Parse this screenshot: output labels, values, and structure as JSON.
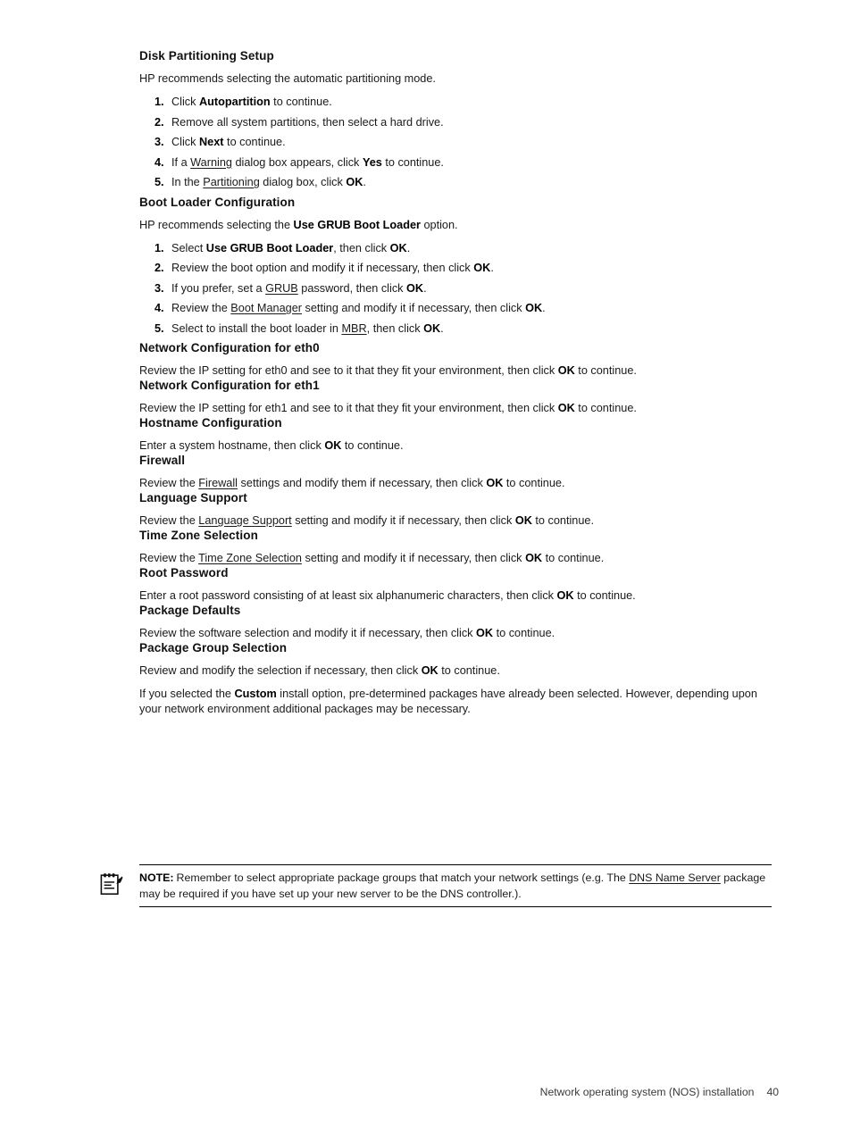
{
  "document": {
    "footer_text": "Network operating system (NOS) installation",
    "page_number": "40"
  },
  "sections": [
    {
      "id": "disk-partitioning-setup",
      "title": "Disk Partitioning Setup",
      "intro": "HP recommends selecting the automatic partitioning mode.",
      "steps": [
        {
          "num": "1.",
          "text_html": "Click <b>Autopartition</b> to continue."
        },
        {
          "num": "2.",
          "text_html": "Remove all system partitions, then select a hard drive."
        },
        {
          "num": "3.",
          "text_html": "Click <b>Next</b> to continue."
        },
        {
          "num": "4.",
          "text_html": "If a <u class=\"term\">Warning</u> dialog box appears, click <b>Yes</b> to continue."
        },
        {
          "num": "5.",
          "text_html": "In the <u class=\"term\">Partitioning</u> dialog box, click <b>OK</b>."
        }
      ]
    },
    {
      "id": "boot-loader-configuration",
      "title": "Boot Loader Configuration",
      "intro_html": "HP recommends selecting the <b>Use GRUB Boot Loader</b> option.",
      "steps": [
        {
          "num": "1.",
          "text_html": "Select <b>Use GRUB Boot Loader</b>, then click <b>OK</b>."
        },
        {
          "num": "2.",
          "text_html": "Review the boot option and modify it if necessary, then click <b>OK</b>."
        },
        {
          "num": "3.",
          "text_html": "If you prefer, set a <u class=\"term\">GRUB</u> password, then click <b>OK</b>."
        },
        {
          "num": "4.",
          "text_html": "Review the <u class=\"term\">Boot Manager</u> setting and modify it if necessary, then click <b>OK</b>."
        },
        {
          "num": "5.",
          "text_html": "Select to install the boot loader in <u class=\"term\">MBR</u>, then click <b>OK</b>."
        }
      ]
    },
    {
      "id": "network-configuration-eth0",
      "title": "Network Configuration for eth0",
      "body_html": "Review the IP setting for eth0 and see to it that they fit your environment, then click <b>OK</b> to continue."
    },
    {
      "id": "network-configuration-eth1",
      "title": "Network Configuration for eth1",
      "body_html": "Review the IP setting for eth1 and see to it that they fit your environment, then click <b>OK</b> to continue."
    },
    {
      "id": "hostname-configuration",
      "title": "Hostname Configuration",
      "body_html": "Enter a system hostname, then click <b>OK</b> to continue."
    },
    {
      "id": "firewall",
      "title": "Firewall",
      "body_html": "Review the <u class=\"term\">Firewall</u> settings and modify them if necessary, then click <b>OK</b> to continue."
    },
    {
      "id": "language-support",
      "title": "Language Support",
      "body_html": "Review the <u class=\"term\">Language Support</u> setting and modify it if necessary, then click <b>OK</b> to continue."
    },
    {
      "id": "time-zone-selection",
      "title": "Time Zone Selection",
      "body_html": "Review the <u class=\"term\">Time Zone Selection</u> setting and modify it if necessary, then click <b>OK</b> to continue."
    },
    {
      "id": "root-password",
      "title": "Root Password",
      "body_html": "Enter a root password consisting of at least six alphanumeric characters, then click <b>OK</b> to continue."
    },
    {
      "id": "package-defaults",
      "title": "Package Defaults",
      "body_html": "Review the software selection and modify it if necessary, then click <b>OK</b> to continue."
    },
    {
      "id": "package-group-selection",
      "title": "Package Group Selection",
      "body_html": "Review and modify the selection if necessary, then click <b>OK</b> to continue.",
      "body2_html": "If you selected the <b>Custom</b> install option, pre-determined packages have already been selected. However, depending upon your network environment additional packages may be necessary."
    }
  ],
  "note": {
    "icon": "note-clipboard-pencil-icon",
    "label": "NOTE:",
    "text_html": "Remember to select appropriate package groups that match your network settings (e.g. The <u class=\"term\">DNS Name Server</u> package may be required if you have set up your new server to be the DNS controller.)."
  }
}
